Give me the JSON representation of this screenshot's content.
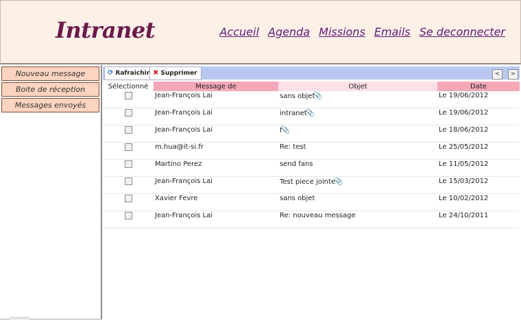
{
  "header": {
    "logo": "Intranet",
    "nav": [
      "Accueil",
      "Agenda",
      "Missions",
      "Emails",
      "Se deconnecter"
    ]
  },
  "sidebar": {
    "items": [
      "Nouveau message",
      "Boite de réception",
      "Messages envoyés"
    ]
  },
  "toolbar": {
    "refresh_label": "Rafraichir",
    "delete_label": "Supprimer",
    "prev_label": "<",
    "next_label": ">"
  },
  "table": {
    "columns": [
      "Sélectionné",
      "Message de",
      "Objet",
      "Date"
    ],
    "rows": [
      {
        "from": "Jean-François Lai",
        "subject": "sans objet",
        "date": "Le 19/06/2012",
        "attachment": true
      },
      {
        "from": "Jean-François Lai",
        "subject": "intranet",
        "date": "Le 19/06/2012",
        "attachment": true
      },
      {
        "from": "Jean-François Lai",
        "subject": "f",
        "date": "Le 18/06/2012",
        "attachment": true
      },
      {
        "from": "m.hua@it-si.fr",
        "subject": "Re: test",
        "date": "Le 25/05/2012",
        "attachment": false
      },
      {
        "from": "Martino Perez",
        "subject": "send fans",
        "date": "Le 11/05/2012",
        "attachment": false
      },
      {
        "from": "Jean-François Lai",
        "subject": "Test piece jointe",
        "date": "Le 15/03/2012",
        "attachment": true
      },
      {
        "from": "Xavier Fevre",
        "subject": "sans objet",
        "date": "Le 10/02/2012",
        "attachment": false
      },
      {
        "from": "Jean-François Lai",
        "subject": "Re: nouveau message",
        "date": "Le 24/10/2011",
        "attachment": false
      }
    ]
  },
  "colors": {
    "header_bg": "#fdf0e6",
    "logo": "#6a1a4a",
    "nav_link": "#5a1a78",
    "sidebar_btn": "#fcd4c0",
    "toolbar": "#b8c8f0",
    "header_col_pink": "#f4a8b8",
    "header_col_light": "#fce0e6"
  }
}
